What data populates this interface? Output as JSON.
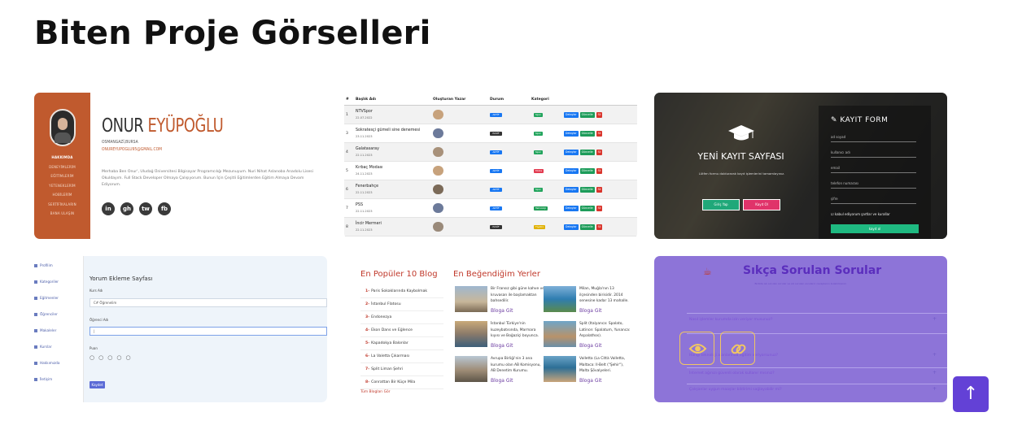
{
  "page": {
    "title": "Biten Proje Görselleri"
  },
  "gallery": {
    "cv": {
      "first_name": "ONUR",
      "last_name": "EYÜPOĞLU",
      "location": "OSMANGAZİ,BURSA",
      "email": "ONUREYUPOGLU95@GMAIL.COM",
      "menu": [
        "HAKKIMDA",
        "DENEYİMLERİM",
        "EĞİTİMLERİM",
        "YETENEKLERİM",
        "HOBİLERİM",
        "SERTİFİKALARIN",
        "BANA ULAŞIN"
      ],
      "about": "Merhaba Ben Onur', Uludağ Üniversitesi Bilgisayar Programcılığı Mezunuyum. Nuri Nihat Aslanoba Anadolu Lisesi Okuldayım. Full Stack Developer Olmaya Çalışıyorum. Bunun İçin Çeşitli Eğitimlerden Eğitim Almaya Devam Ediyorum.",
      "social": [
        "in",
        "gh",
        "tw",
        "fb"
      ]
    },
    "table": {
      "headers": [
        "#",
        "Başlık Adı",
        "Oluşturan Yazar",
        "Durum",
        "Kategori"
      ],
      "rows": [
        {
          "num": "1",
          "name": "NTVSpor",
          "date": "22.07.2022",
          "status": "AKTİF",
          "category": "Spor"
        },
        {
          "num": "3",
          "name": "Sokratesçi gümeli sine denemesi",
          "date": "23.11.2023",
          "status": "PASİF",
          "category": "Spor"
        },
        {
          "num": "4",
          "name": "Galatasaray",
          "date": "22.11.2023",
          "status": "AKTİF",
          "category": "Spor"
        },
        {
          "num": "5",
          "name": "Kırbaç Modası",
          "date": "24.11.2023",
          "status": "AKTİF",
          "category": "Moda"
        },
        {
          "num": "6",
          "name": "Fenerbahçe",
          "date": "22.11.2023",
          "status": "AKTİF",
          "category": "Spor"
        },
        {
          "num": "7",
          "name": "PSS",
          "date": "22.11.2023",
          "status": "AKTİF",
          "category": "Teknoloji"
        },
        {
          "num": "8",
          "name": "İncir Mermeri",
          "date": "22.11.2023",
          "status": "PASİF",
          "category": "Tiyatro"
        }
      ],
      "buttons": [
        "Detaylar",
        "Güncelle",
        "Sil"
      ]
    },
    "register": {
      "heading": "YENİ KAYIT SAYFASI",
      "subtext": "Lütfen formu doldurarak kayıt işlemlerini tamamlayınız.",
      "button_login": "Giriş Yap",
      "button_signup": "Kayıt Ol",
      "form_title": "KAYIT FORM",
      "fields": [
        "ad soyad",
        "kullanıcı adı",
        "email",
        "telefon numarası",
        "şifre"
      ],
      "agree_label": "kabul ediyorum şartlar ve kurallar",
      "submit": "kayıt ol"
    },
    "comment": {
      "sidebar": [
        "Profilim",
        "Kategoriler",
        "Eğitmenler",
        "Öğrenciler",
        "Makaleler",
        "Kurslar",
        "Hakkımızda",
        "İletişim"
      ],
      "heading": "Yorum Ekleme Sayfası",
      "course_label": "Kurs Adı",
      "course_value": "C# Öğrenelim",
      "student_label": "Öğrenci Adı",
      "rating_label": "Puan",
      "stars": "○ ○ ○ ○ ○",
      "submit": "Kaydet"
    },
    "blog": {
      "popular_title": "En Popüler 10 Blog",
      "liked_title": "En Beğendiğim Yerler",
      "popular": [
        "Paris Sokaklarında Kaybolmak",
        "İstanbul Flatosu",
        "Endonezya",
        "Ekon Dans ve Eğlence",
        "Kapadokya Balonlar",
        "La Valetta Çıkarması",
        "Split Liman Şehri",
        "Conrattan Bir Küçe Mila"
      ],
      "all_link": "Tüm Blogları Gör",
      "cards": [
        {
          "text": "Bir Fransız gibi güne kahve ve kruvasan ile başlamaktan bahsedilir.",
          "link": "Bloga Git"
        },
        {
          "text": "Milan, Muğla'nın 13 ilçesinden birisidir. 2014 senesine kadar 13 mahalle.",
          "link": "Bloga Git"
        },
        {
          "text": "İstanbul Türkiye'nin kuzeybatısında, Marmara kıyısı ve Boğaziçi boyunca.",
          "link": "Bloga Git"
        },
        {
          "text": "Split (Italyanca: Spalato, Latince: Spalatum, Yunanca: Aspalathos).",
          "link": "Bloga Git"
        },
        {
          "text": "Avrupa Birliği'nin 3 ana kurumu olan AB Komisyonu, AB Denetim Kurumu.",
          "link": "Bloga Git"
        },
        {
          "text": "Valletta (La Città Valletta, Maltaca: Il-Belt (\"Şehir\"), Malta Şövalyeleri.",
          "link": "Bloga Git"
        }
      ]
    },
    "faq": {
      "title": "Sıkça Sorulan Sorular",
      "description": "Birlikte sık sorulan sorular ve sık sorulan soruların cevaplarını bulabilirsiniz.",
      "questions": [
        "Nasıl işlemler kurumda izin veriyor musunuz?",
        "Hangi teknoloji alanlarında eğitim veriyorsunuz?",
        "İnternet ağınızı güvenli olarak kullanır mısınız?",
        "Çalışanlar uygun maaşlar bildirimi sağlayabilir mi?"
      ]
    },
    "colors": {
      "cv_accent": "#c05a2e",
      "faq_bg": "#8d74d8",
      "scroll_button": "#6341d6"
    }
  },
  "scroll_top": {
    "icon": "↑"
  }
}
